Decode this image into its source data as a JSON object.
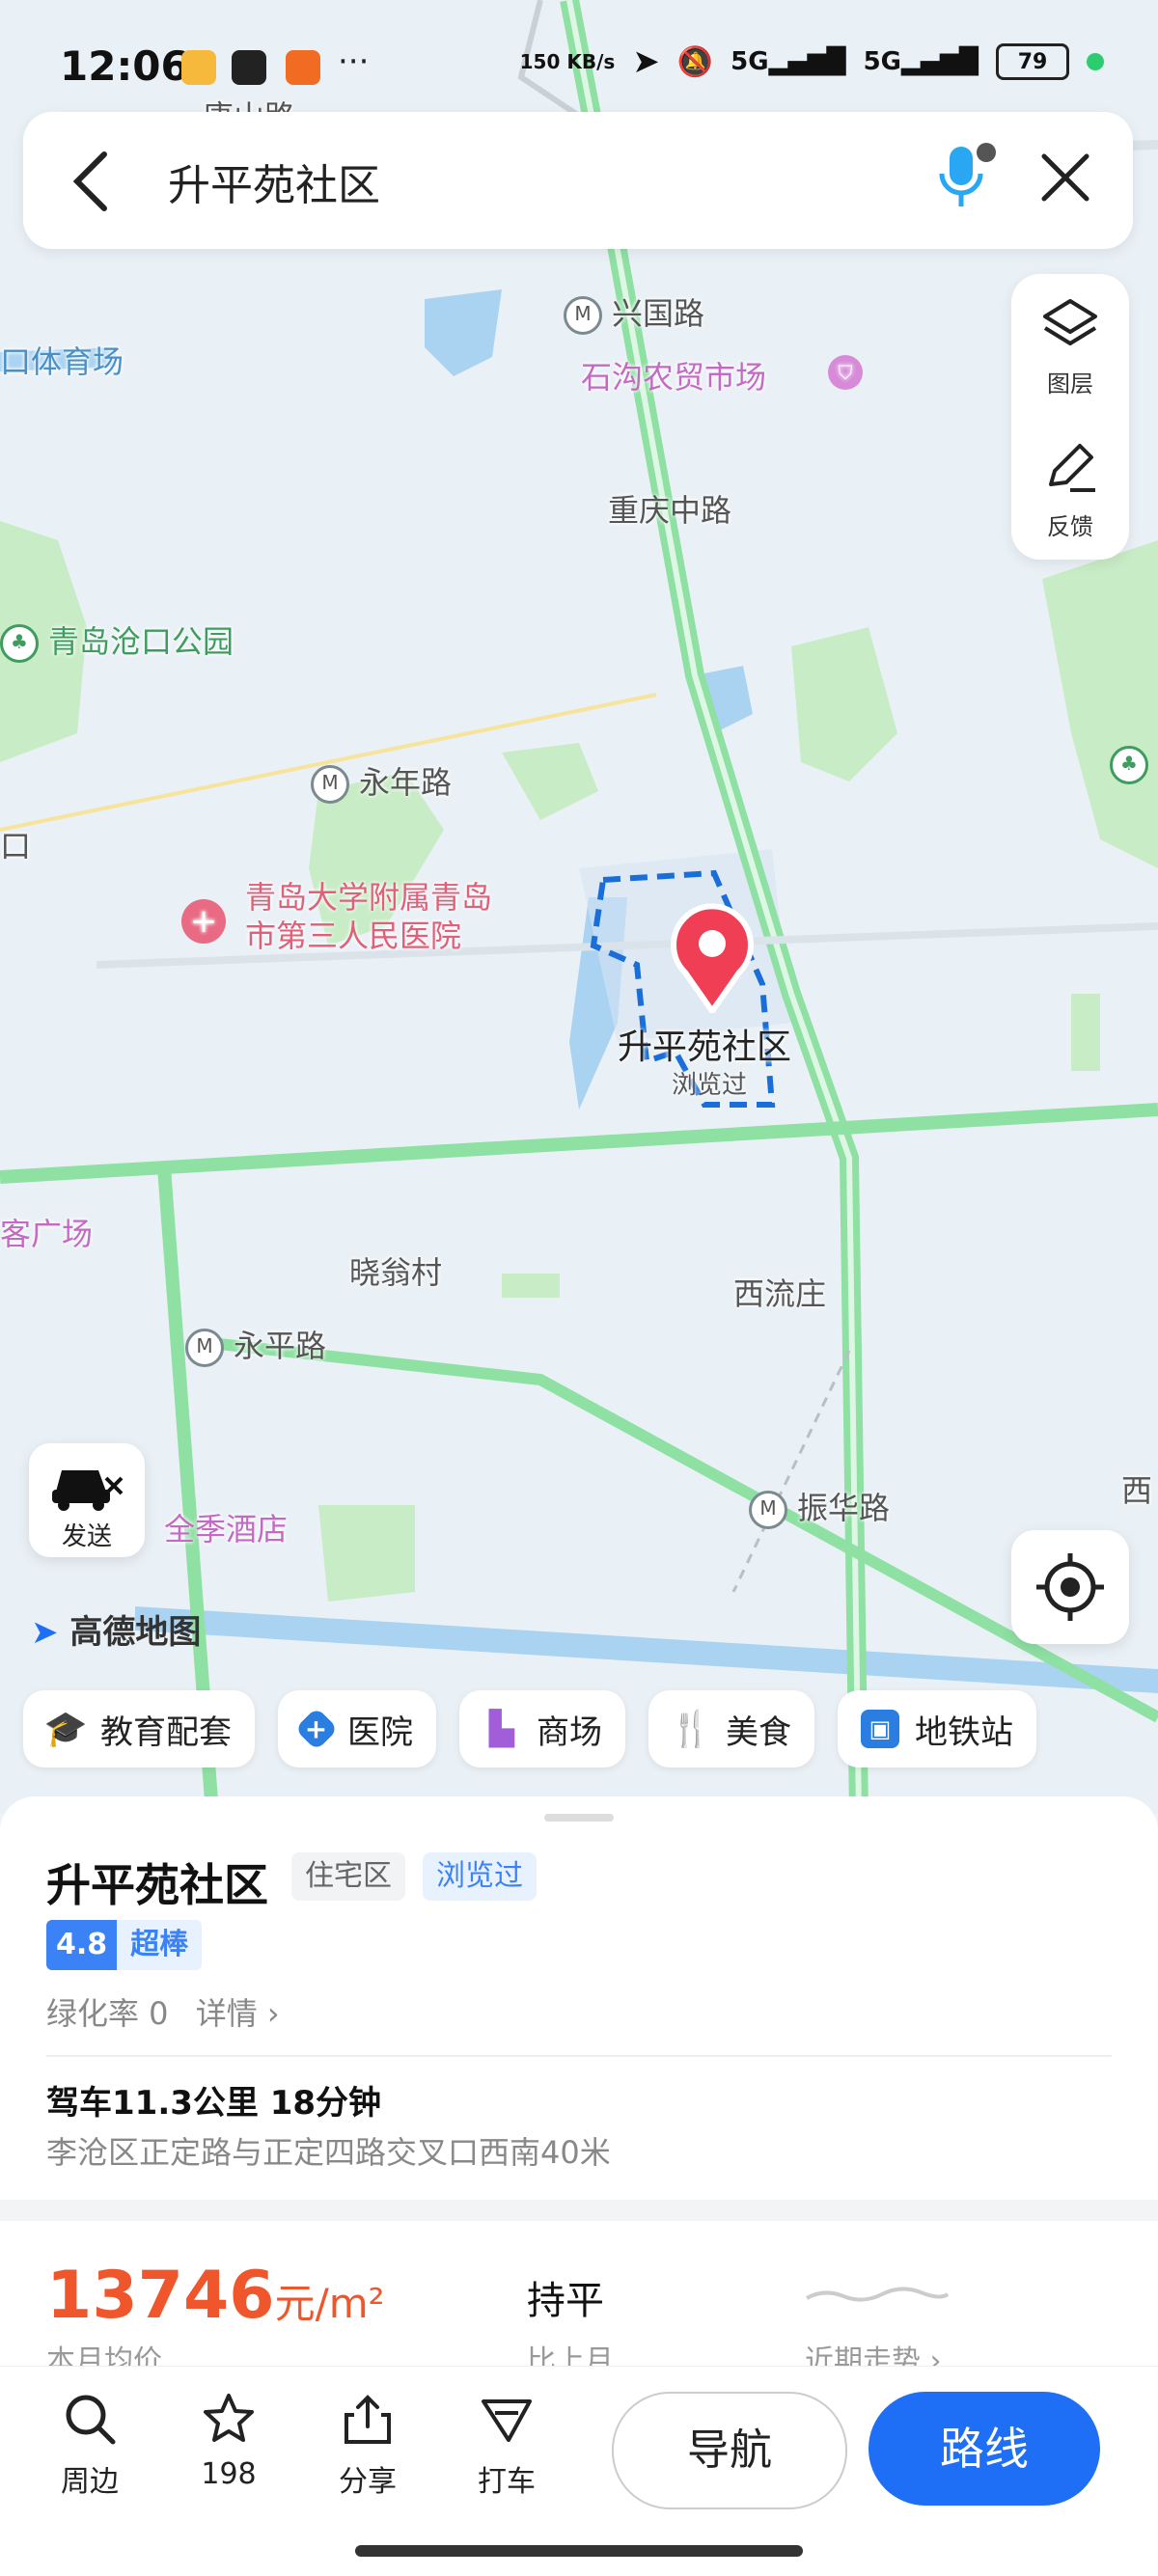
{
  "status": {
    "time": "12:06",
    "net_speed": "150 KB/s",
    "signal1": "5G",
    "signal2": "5G",
    "battery": "79"
  },
  "search": {
    "query": "升平苑社区"
  },
  "tools": {
    "layers": "图层",
    "feedback": "反馈"
  },
  "map": {
    "labels": {
      "tangshan": "唐山路",
      "xingguo": "兴国路",
      "shigou": "石沟农贸市场",
      "stadium": "口体育场",
      "chongqing": "重庆中路",
      "cangkou_park": "青岛沧口公园",
      "yongnian": "永年路",
      "hospital1": "青岛大学附属青岛",
      "hospital2": "市第三人民医院",
      "poi": "升平苑社区",
      "viewed": "浏览过",
      "plaza": "客广场",
      "xiaoweng": "晓翁村",
      "xiliu": "西流庄",
      "yongping": "永平路",
      "hotel": "全季酒店",
      "zhenhua": "振华路",
      "xi": "西",
      "kou": "口"
    }
  },
  "send": "发送",
  "logo": "高德地图",
  "chips": [
    "教育配套",
    "医院",
    "商场",
    "美食",
    "地铁站"
  ],
  "place": {
    "name": "升平苑社区",
    "type": "住宅区",
    "viewed": "浏览过",
    "score": "4.8",
    "score_word": "超棒",
    "greening": "绿化率 0",
    "detail": "详情",
    "drive": "驾车11.3公里 18分钟",
    "address": "李沧区正定路与正定四路交叉口西南40米",
    "price": "13746",
    "price_unit": "元/m²",
    "price_sub": "本月均价",
    "trend": "持平",
    "trend_sub": "比上月",
    "recent": "近期走势"
  },
  "actions": {
    "nearby": "周边",
    "favorites": "198",
    "share": "分享",
    "taxi": "打车",
    "navigate": "导航",
    "route": "路线"
  },
  "colors": {
    "accent": "#1e6ff5",
    "price": "#f0562c",
    "road_green": "#8fe0a3"
  }
}
